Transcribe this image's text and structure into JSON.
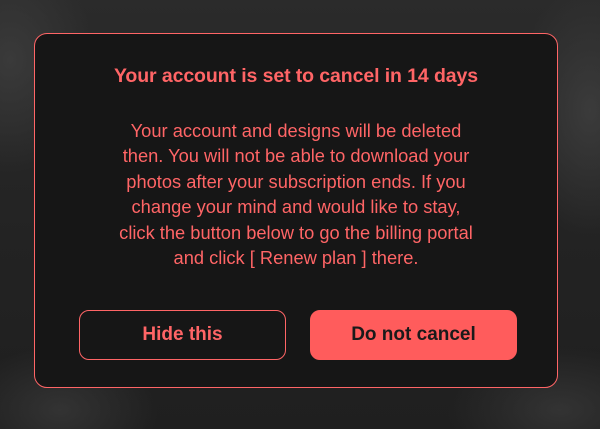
{
  "colors": {
    "accent": "#ff6566",
    "dialog_background": "#161616",
    "primary_button_text": "#1a1a1a"
  },
  "dialog": {
    "title": "Your account is set to cancel in 14 days",
    "message_lines": [
      "Your account and designs will be deleted",
      "then. You will not be able to download your",
      "photos after your subscription ends. If you",
      "change your mind and would like to stay,",
      "click the button below to go the billing portal",
      "and click [ Renew plan ] there."
    ],
    "hide_button_label": "Hide this",
    "keep_button_label": "Do not cancel"
  }
}
